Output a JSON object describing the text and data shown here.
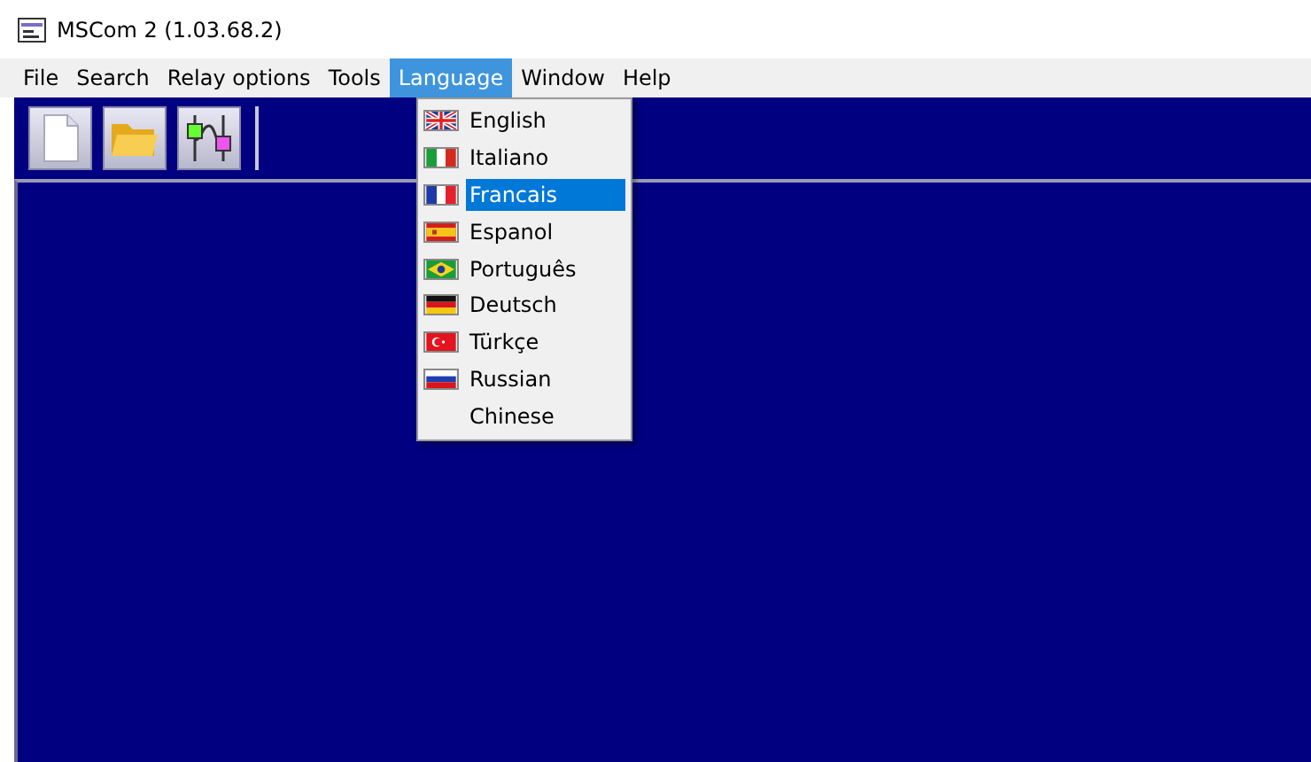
{
  "window": {
    "title": "MSCom 2 (1.03.68.2)"
  },
  "menu_bar": [
    {
      "label": "File",
      "selected": false
    },
    {
      "label": "Search",
      "selected": false
    },
    {
      "label": "Relay options",
      "selected": false
    },
    {
      "label": "Tools",
      "selected": false
    },
    {
      "label": "Language",
      "selected": true
    },
    {
      "label": "Window",
      "selected": false
    },
    {
      "label": "Help",
      "selected": false
    }
  ],
  "language_menu": [
    {
      "label": "English",
      "kind": "uk",
      "selected": false
    },
    {
      "label": "Italiano",
      "kind": "it",
      "selected": false
    },
    {
      "label": "Francais",
      "kind": "fr",
      "selected": true
    },
    {
      "label": "Espanol",
      "kind": "es",
      "selected": false
    },
    {
      "label": "Português",
      "kind": "br",
      "selected": false
    },
    {
      "label": "Deutsch",
      "kind": "de",
      "selected": false
    },
    {
      "label": "Türkçe",
      "kind": "tr",
      "selected": false
    },
    {
      "label": "Russian",
      "kind": "ru",
      "selected": false
    },
    {
      "label": "Chinese",
      "kind": "plain",
      "selected": false
    }
  ]
}
